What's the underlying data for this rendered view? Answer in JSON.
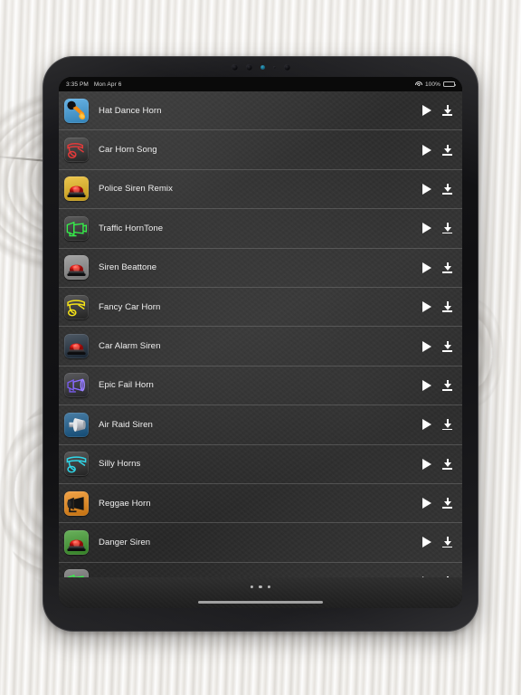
{
  "background": {
    "name": "whitewashed-wood-planks"
  },
  "device": {
    "name": "tablet-mockup",
    "camera_dots": [
      "sensor",
      "camera",
      "indicator-blue",
      "mic",
      "camera"
    ]
  },
  "status_bar": {
    "time": "3:35 PM",
    "date": "Mon Apr 6",
    "wifi_icon": "wifi-icon",
    "battery_percent": "100%",
    "battery_icon": "battery-full-icon"
  },
  "list": {
    "name": "sound-list",
    "play_icon": "play-icon",
    "download_icon": "download-icon",
    "items": [
      {
        "title": "Hat Dance Horn",
        "icon": "air-horn-blue-icon",
        "bg": "#3e9ede",
        "art": "horn-black-orange"
      },
      {
        "title": "Car Horn Song",
        "icon": "car-horn-red-icon",
        "bg": "#2b2b2b",
        "art": "horn-red-outline"
      },
      {
        "title": "Police Siren Remix",
        "icon": "police-beacon-yellow-icon",
        "bg": "#e8b71d",
        "art": "beacon-red"
      },
      {
        "title": "Traffic HornTone",
        "icon": "traffic-horn-green-icon",
        "bg": "#2e2e2e",
        "art": "horn-green-neon"
      },
      {
        "title": "Siren Beattone",
        "icon": "siren-red-gray-icon",
        "bg": "#8c8c8c",
        "art": "beacon-red"
      },
      {
        "title": "Fancy Car Horn",
        "icon": "fancy-horn-yellow-icon",
        "bg": "#2a2a2a",
        "art": "horn-yellow-outline"
      },
      {
        "title": "Car Alarm Siren",
        "icon": "alarm-siren-dark-icon",
        "bg": "#1d2b3a",
        "art": "beacon-red"
      },
      {
        "title": "Epic Fail Horn",
        "icon": "epic-fail-horn-icon",
        "bg": "#2c2c30",
        "art": "horn-purple-neon"
      },
      {
        "title": "Air Raid Siren",
        "icon": "air-raid-speaker-icon",
        "bg": "#175a8c",
        "art": "megaphone-silver"
      },
      {
        "title": "Silly Horns",
        "icon": "silly-horns-cyan-icon",
        "bg": "#2a2a2a",
        "art": "horn-cyan-outline"
      },
      {
        "title": "Reggae Horn",
        "icon": "reggae-horn-orange-icon",
        "bg": "#ef8a14",
        "art": "horn-black-solid"
      },
      {
        "title": "Danger Siren",
        "icon": "danger-siren-green-icon",
        "bg": "#3f9b2e",
        "art": "beacon-red"
      },
      {
        "title": "",
        "icon": "partial-row-icon",
        "bg": "#6f6f6f",
        "art": "horn-green-neon"
      }
    ]
  },
  "bottom_bar": {
    "page_dots": 3,
    "home_indicator": "home-indicator"
  },
  "colors": {
    "screen_bg": "#2e2e2e",
    "separator": "#828282",
    "text": "#efefef",
    "icon_white": "#fdfdfd"
  }
}
